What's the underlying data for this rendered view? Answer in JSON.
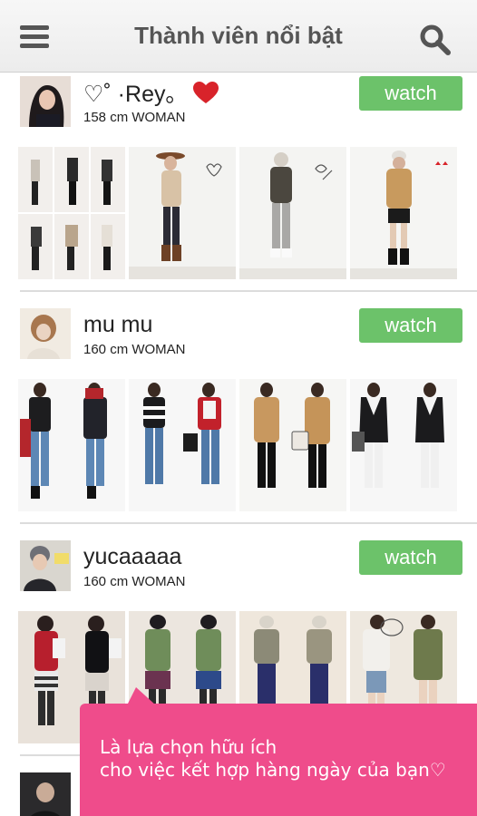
{
  "header": {
    "title": "Thành viên nổi bật",
    "menu_icon": "hamburger-menu-icon",
    "search_icon": "search-icon"
  },
  "members": [
    {
      "name_prefix": "♡˚ ·Rey｡",
      "height_label": "158 cm WOMAN",
      "watch_label": "watch",
      "avatar_tone": "#d6c4b6"
    },
    {
      "name": "mu mu",
      "height_label": "160 cm WOMAN",
      "watch_label": "watch",
      "avatar_tone": "#cbb49b"
    },
    {
      "name": "yucaaaaa",
      "height_label": "160 cm WOMAN",
      "watch_label": "watch",
      "avatar_tone": "#7d7f86"
    }
  ],
  "promo": {
    "line1": "Là lựa chọn hữu ích",
    "line2": "cho việc kết hợp hàng ngày của bạn♡"
  },
  "colors": {
    "accent_green": "#6cc26a",
    "promo_pink": "#ef4c8b",
    "heart_red": "#d8232a"
  }
}
